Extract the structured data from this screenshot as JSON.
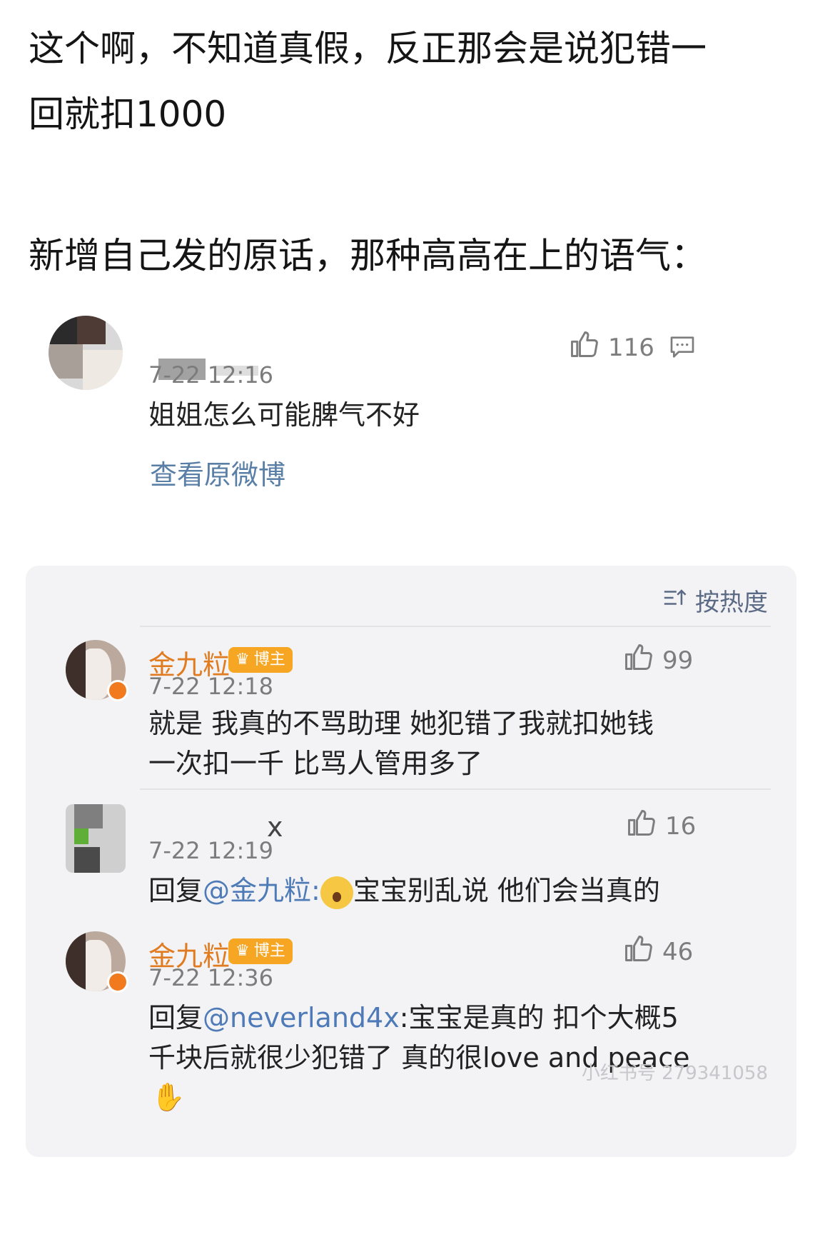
{
  "post": {
    "line1": "这个啊，不知道真假，反正那会是说犯错一",
    "line2": "回就扣1000",
    "line3": "新增自己发的原话，那种高高在上的语气："
  },
  "original": {
    "timestamp": "7-22 12:16",
    "text": "姐姐怎么可能脾气不好",
    "likes": "116",
    "view_original": "查看原微博",
    "icons": [
      "thumb-up-icon",
      "comment-icon"
    ]
  },
  "comments_panel": {
    "sort_label": "按热度",
    "comments": [
      {
        "name": "金九粒",
        "badge": "博主",
        "timestamp": "7-22 12:18",
        "likes": "99",
        "line1": "就是 我真的不骂助理 她犯错了我就扣她钱",
        "line2": "一次扣一千 比骂人管用多了"
      },
      {
        "name_suffix": "x",
        "timestamp": "7-22 12:19",
        "likes": "16",
        "reply_prefix": "回复",
        "mention": "@金九粒:",
        "text": "宝宝别乱说 他们会当真的"
      },
      {
        "name": "金九粒",
        "badge": "博主",
        "timestamp": "7-22 12:36",
        "likes": "46",
        "reply_prefix": "回复",
        "mention": "@neverland4x",
        "line1_rest": ":宝宝是真的 扣个大概5",
        "line2": "千块后就很少犯错了 真的很love and peace"
      }
    ],
    "watermark": "小红书号 279341058"
  },
  "colors": {
    "blogger_name": "#e07b20",
    "badge": "#f6a623",
    "link": "#5a7fa6",
    "mention": "#4e7bb8",
    "panel_bg": "#f3f3f5"
  }
}
